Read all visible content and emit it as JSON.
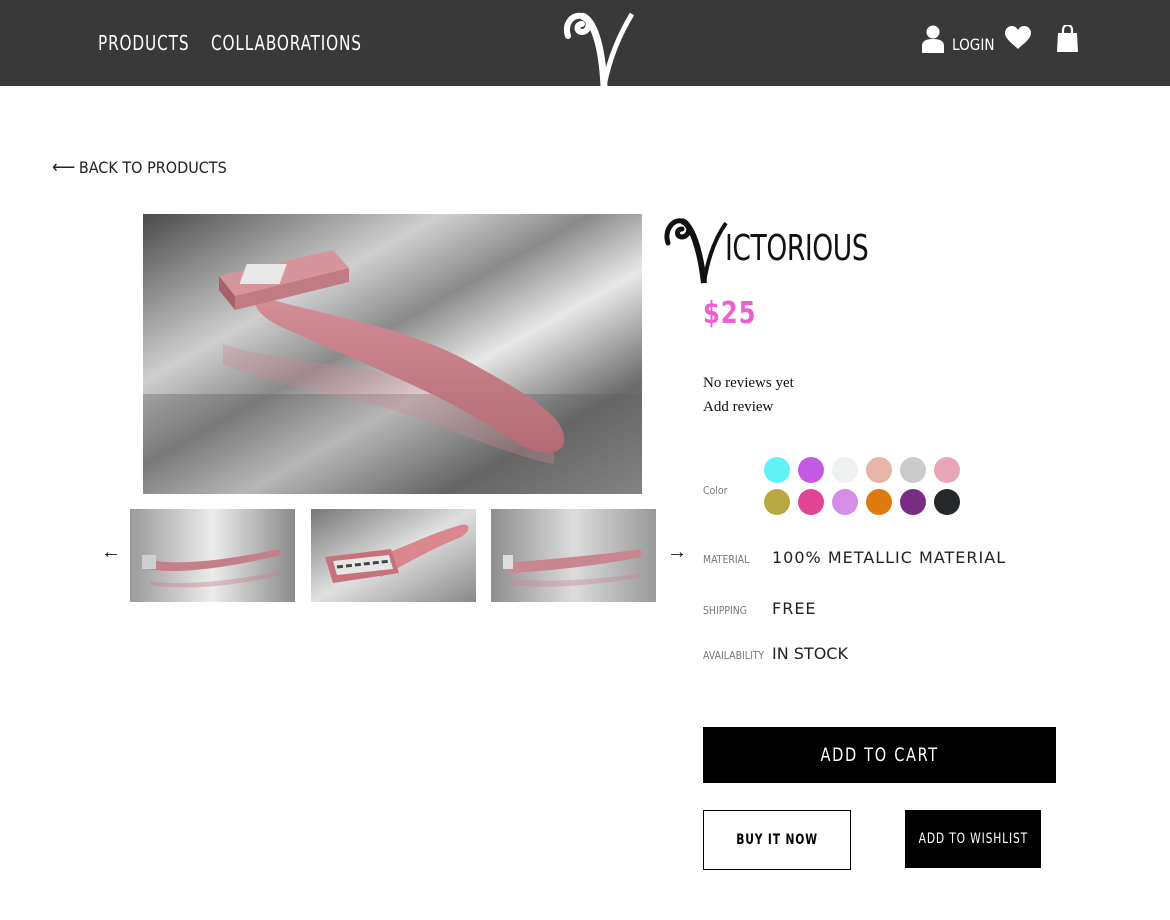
{
  "header": {
    "nav": [
      "PRODUCTS",
      "COLLABORATIONS"
    ],
    "login_label": "LOGIN",
    "icons": [
      "brand-logo-icon",
      "user-icon",
      "heart-icon",
      "shopping-bag-icon"
    ]
  },
  "back_link": {
    "label": "BACK TO PRODUCTS",
    "icon": "arrow-left-icon"
  },
  "gallery": {
    "main_image": "pink-razor-photo",
    "thumbnails": [
      "pink-razor-side-view",
      "pink-razor-blade-view",
      "pink-razor-profile-view"
    ],
    "prev_arrow": "←",
    "next_arrow": "→"
  },
  "product": {
    "name": "ICTORIOUS",
    "logo_letter_icon": "v-logo-icon",
    "price": "$25",
    "reviews": "No reviews yet",
    "add_review": "Add review",
    "color_label": "Color",
    "colors": [
      "#5ff3f8",
      "#c35ae6",
      "#eef1f0",
      "#e8b4a8",
      "#cbcbcb",
      "#e6a6b8",
      "#b9a741",
      "#e04595",
      "#d58ee8",
      "#e07a0c",
      "#7a2c82",
      "#262728"
    ],
    "material_label": "MATERIAL",
    "material": "100% METALLIC MATERIAL",
    "shipping_label": "SHIPPING",
    "shipping": "FREE",
    "availability_label": "AVAILABILITY",
    "availability": "IN STOCK"
  },
  "actions": {
    "add_to_cart": "ADD TO CART",
    "buy_now": "BUY IT NOW",
    "add_to_wishlist": "ADD TO WISHLIST"
  },
  "colors_theme": {
    "header_bg": "#393939",
    "price": "#ee5fcf"
  }
}
